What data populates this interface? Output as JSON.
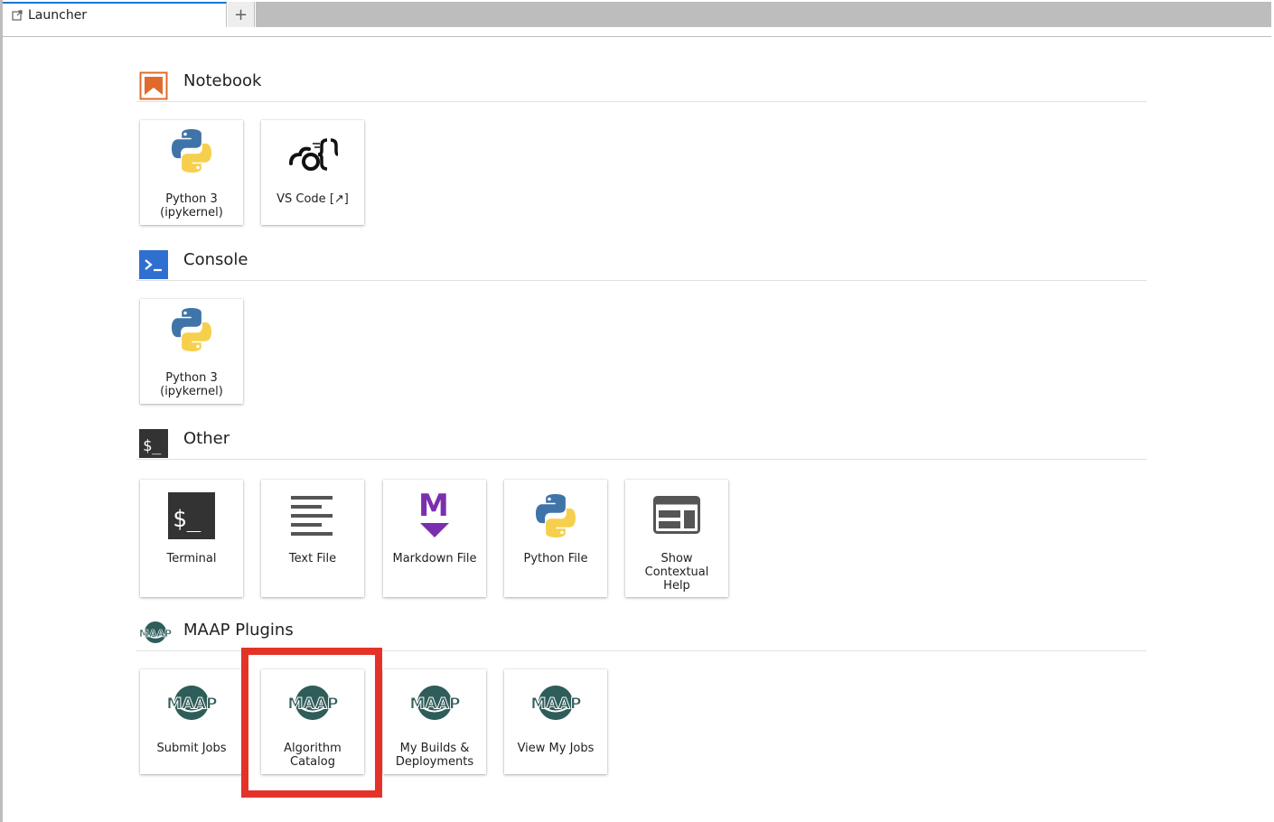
{
  "tabs": {
    "active_label": "Launcher",
    "add_label": "+"
  },
  "sections": {
    "notebook": {
      "title": "Notebook",
      "items": [
        {
          "label": "Python 3\n(ipykernel)"
        },
        {
          "label": "VS Code [↗]"
        }
      ]
    },
    "console": {
      "title": "Console",
      "items": [
        {
          "label": "Python 3\n(ipykernel)"
        }
      ]
    },
    "other": {
      "title": "Other",
      "items": [
        {
          "label": "Terminal"
        },
        {
          "label": "Text File"
        },
        {
          "label": "Markdown File"
        },
        {
          "label": "Python File"
        },
        {
          "label": "Show\nContextual\nHelp"
        }
      ]
    },
    "maap": {
      "title": "MAAP Plugins",
      "items": [
        {
          "label": "Submit Jobs"
        },
        {
          "label": "Algorithm\nCatalog"
        },
        {
          "label": "My Builds &\nDeployments"
        },
        {
          "label": "View My Jobs"
        }
      ]
    }
  },
  "icons": {
    "notebook": "notebook-icon",
    "console": "console-icon",
    "other": "terminal-icon",
    "maap": "maap-logo-icon"
  },
  "colors": {
    "accent": "#1976d2",
    "notebook_orange": "#e06a2c",
    "console_blue": "#2f6fd0",
    "maap_green": "#2f5d5a",
    "markdown_purple": "#7b2fae",
    "highlight_red": "#e53228"
  }
}
